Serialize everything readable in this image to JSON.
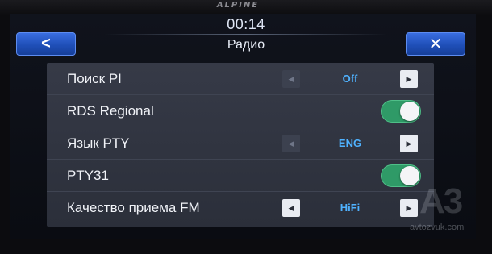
{
  "device": {
    "brand": "ALPINE"
  },
  "header": {
    "time": "00:14",
    "title": "Радио",
    "back_label": "<",
    "close_label": "✕"
  },
  "settings": [
    {
      "label": "Поиск PI",
      "type": "selector",
      "value": "Off",
      "left_arrow": "◀",
      "right_arrow": "▶",
      "left_enabled": false
    },
    {
      "label": "RDS Regional",
      "type": "toggle",
      "on": true
    },
    {
      "label": "Язык PTY",
      "type": "selector",
      "value": "ENG",
      "left_arrow": "◀",
      "right_arrow": "▶",
      "left_enabled": false
    },
    {
      "label": "PTY31",
      "type": "toggle",
      "on": true
    },
    {
      "label": "Качество приема FM",
      "type": "selector",
      "value": "HiFi",
      "left_arrow": "◀",
      "right_arrow": "▶",
      "left_enabled": true
    }
  ],
  "watermark": {
    "logo": "A3",
    "url": "avtozvuk.com"
  },
  "colors": {
    "accent_blue": "#2a5fd0",
    "value_text": "#4fb2ff",
    "toggle_on": "#2f9a67"
  }
}
